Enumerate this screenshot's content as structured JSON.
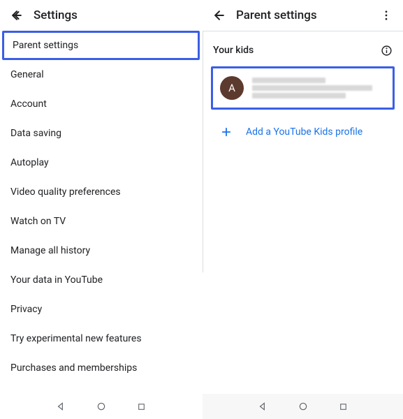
{
  "left": {
    "title": "Settings",
    "items": [
      "Parent settings",
      "General",
      "Account",
      "Data saving",
      "Autoplay",
      "Video quality preferences",
      "Watch on TV",
      "Manage all history",
      "Your data in YouTube",
      "Privacy",
      "Try experimental new features",
      "Purchases and memberships"
    ]
  },
  "right": {
    "title": "Parent settings",
    "section": "Your kids",
    "kid_initial": "A",
    "add_label": "Add a YouTube Kids profile"
  },
  "colors": {
    "highlight": "#3b5ee5",
    "link": "#1a73e8",
    "avatar": "#5d3a2e"
  }
}
